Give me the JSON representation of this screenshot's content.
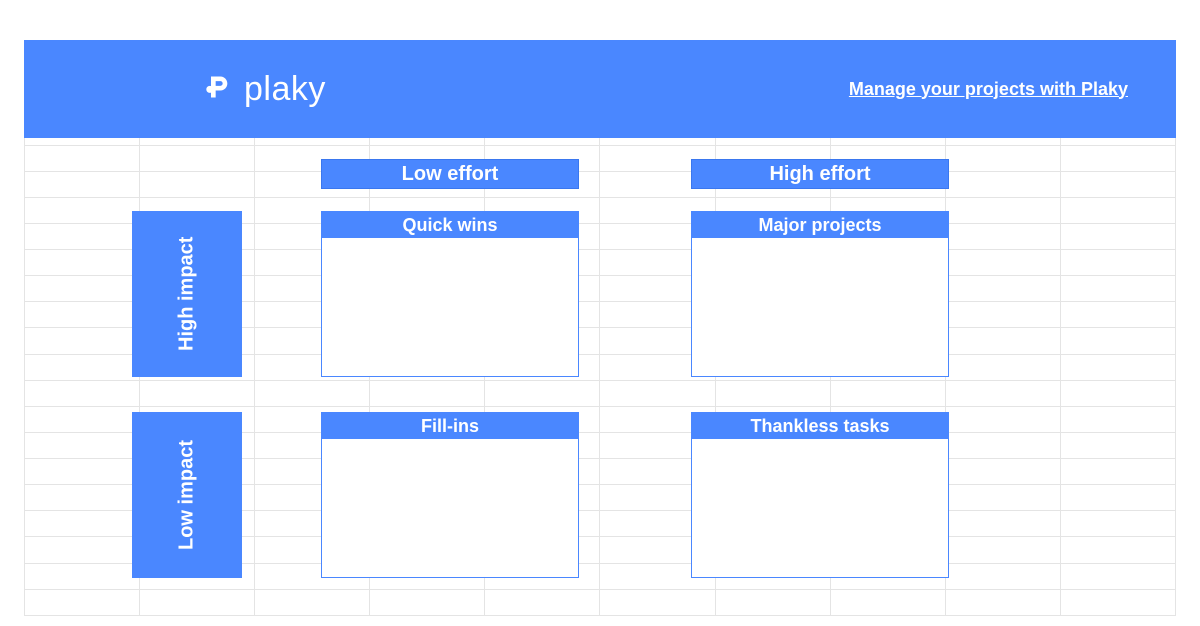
{
  "colors": {
    "accent": "#4a87ff"
  },
  "header": {
    "brand_name": "plaky",
    "link_text": "Manage your projects with Plaky"
  },
  "matrix": {
    "columns": {
      "low_effort": "Low effort",
      "high_effort": "High effort"
    },
    "rows": {
      "high_impact": "High impact",
      "low_impact": "Low impact"
    },
    "quadrants": {
      "top_left": "Quick wins",
      "top_right": "Major projects",
      "bottom_left": "Fill-ins",
      "bottom_right": "Thankless tasks"
    }
  }
}
